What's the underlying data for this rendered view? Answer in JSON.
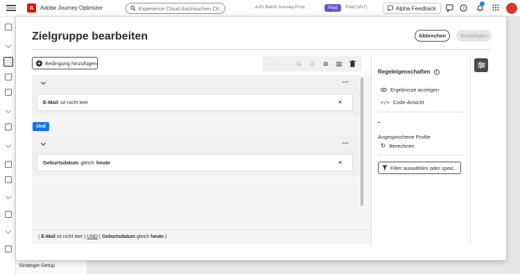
{
  "app": {
    "title": "Adobe Journey Optimizer",
    "logo_letter": "A",
    "search_placeholder": "Experience Cloud durchsuchen Ctr...",
    "sandbox_label": "AJO Batch Journey Prod",
    "sandbox_tag": "Prod",
    "sandbox_env": "Prod (VA7)",
    "feedback_label": "Alpha Feedback"
  },
  "background": {
    "strategy_label": "Strategie-Setup"
  },
  "modal": {
    "title": "Zielgruppe bearbeiten",
    "cancel_label": "Abbrechen",
    "confirm_label": "Bestätigen"
  },
  "editor": {
    "add_condition_label": "Bedingung hinzufügen",
    "toolbar_icons": [
      "arrow-up-icon",
      "arrow-down-icon",
      "group-icon",
      "ungroup-icon",
      "copy-icon",
      "paste-icon",
      "delete-icon"
    ],
    "groups": [
      {
        "field": "E-Mail",
        "operator": "ist nicht leer",
        "value": ""
      },
      {
        "field": "Geburtsdatum",
        "operator": "gleich",
        "value": "heute"
      }
    ],
    "join_operator": "Und",
    "expression": {
      "part1_field": "E-Mail",
      "part1_op": "ist nicht leer",
      "join": "UND",
      "part2_field": "Geburtsdatum",
      "part2_op": "gleich",
      "part2_value": "heute"
    }
  },
  "properties": {
    "title": "Regeleigenschaften",
    "show_results_label": "Ergebnisse anzeigen",
    "code_view_label": "Code-Ansicht",
    "profile_count": "-",
    "profiles_label": "Angesprochene Profile",
    "calculate_label": "Berechnen",
    "filter_label": "Filter auswählen oder speic..."
  }
}
